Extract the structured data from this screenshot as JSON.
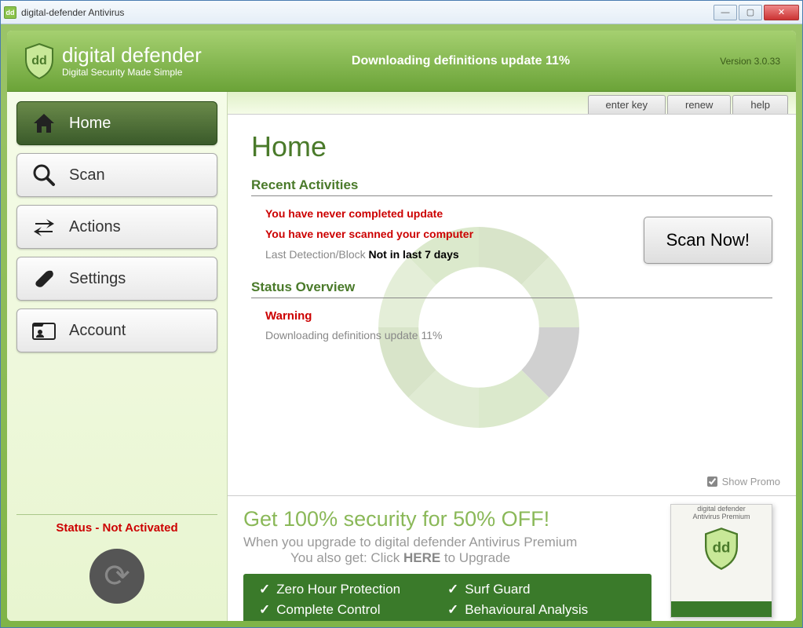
{
  "titlebar": {
    "text": "digital-defender Antivirus"
  },
  "header": {
    "logo_title": "digital defender",
    "logo_sub": "Digital Security Made Simple",
    "status": "Downloading definitions update 11%",
    "version": "Version 3.0.33"
  },
  "sidebar": {
    "items": [
      {
        "label": "Home"
      },
      {
        "label": "Scan"
      },
      {
        "label": "Actions"
      },
      {
        "label": "Settings"
      },
      {
        "label": "Account"
      }
    ],
    "status": "Status - Not Activated"
  },
  "tabs": {
    "enter_key": "enter key",
    "renew": "renew",
    "help": "help"
  },
  "main": {
    "title": "Home",
    "recent_title": "Recent Activities",
    "update_warn": "You have never completed update",
    "scan_warn": "You have never scanned your computer",
    "detect_label": "Last Detection/Block",
    "detect_value": "Not in last 7 days",
    "scan_now": "Scan Now!",
    "status_title": "Status Overview",
    "status_warn": "Warning",
    "status_msg": "Downloading definitions update 11%",
    "show_promo": "Show Promo"
  },
  "promo": {
    "title": "Get 100% security for 50% OFF!",
    "sub": "When you upgrade to digital defender Antivirus Premium",
    "upgrade_pre": "You also get:  Click ",
    "upgrade_here": "HERE",
    "upgrade_post": " to Upgrade",
    "features": {
      "col1": [
        "Zero Hour Protection",
        "Complete Control"
      ],
      "col2": [
        "Surf Guard",
        "Behavioural Analysis"
      ]
    },
    "box_title": "digital defender",
    "box_sub": "Antivirus Premium"
  }
}
